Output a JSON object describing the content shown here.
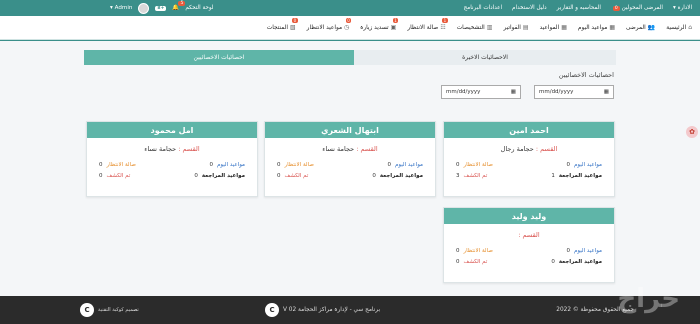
{
  "topbar": {
    "admin_menu": "الادارة ▾",
    "responsible_patients": "المرضى المحولين",
    "responsible_badge": "0",
    "accounts_reports": "المحاسبه و التقارير",
    "user_guide": "دليل الاستخدام",
    "program_settings": "اعدادات البرنامج",
    "dashboard": "لوحة التحكم",
    "notif_count": "+8",
    "bell_badge": "5",
    "admin_label": "Admin ▾"
  },
  "navbar": {
    "items": [
      {
        "label": "الرئيسية",
        "icon": "home-icon",
        "badge": ""
      },
      {
        "label": "المرضى",
        "icon": "users-icon",
        "badge": ""
      },
      {
        "label": "مواعيد اليوم",
        "icon": "calendar-icon",
        "badge": ""
      },
      {
        "label": "المواعيد",
        "icon": "calendar-icon",
        "badge": ""
      },
      {
        "label": "الفواتير",
        "icon": "invoice-icon",
        "badge": ""
      },
      {
        "label": "التشخيصات",
        "icon": "diagnosis-icon",
        "badge": ""
      },
      {
        "label": "صالة الانتظار",
        "icon": "waiting-icon",
        "badge": "1"
      },
      {
        "label": "تسديد زيارة",
        "icon": "payment-icon",
        "badge": "1"
      },
      {
        "label": "مواعيد الانتظار",
        "icon": "clock-icon",
        "badge": "0"
      },
      {
        "label": "المنتجات",
        "icon": "products-icon",
        "badge": "0"
      }
    ]
  },
  "tabs": {
    "recent_stats": "الاحصائيات الاخيرة",
    "specialist_stats": "احصائيات الاخصائيين"
  },
  "section_title": "احصائيات الاخصائيين",
  "date_inputs": [
    {
      "placeholder": "mm/dd/yyyy"
    },
    {
      "placeholder": "mm/dd/yyyy"
    }
  ],
  "labels": {
    "dept": "القسم :",
    "today_appointments": "مواعيد اليوم",
    "waiting_hall": "صالة الانتظار",
    "review_appointments": "مواعيد المراجعة",
    "examined": "تم الكشف"
  },
  "cards": [
    {
      "name": "احمد امين",
      "dept": "حجامة رجال",
      "today": "0",
      "waiting": "0",
      "review": "1",
      "examined": "3"
    },
    {
      "name": "ابتهال الشعري",
      "dept": "حجامة نساء",
      "today": "0",
      "waiting": "0",
      "review": "0",
      "examined": "0"
    },
    {
      "name": "امل محمود",
      "dept": "حجامة نساء",
      "today": "0",
      "waiting": "0",
      "review": "0",
      "examined": "0"
    },
    {
      "name": "وليد وليد",
      "dept": "",
      "today": "0",
      "waiting": "0",
      "review": "0",
      "examined": "0"
    }
  ],
  "footer": {
    "copyright": "جميع الحقوق محفوظة © 2022",
    "program": "برنامج سي - لإدارة مراكز الحجامة V 02",
    "design": "تصميم كوكبة التقنية",
    "watermark": "حراج"
  },
  "colors": {
    "teal": "#3a8f8a",
    "card_header": "#5fb5a8",
    "badge_red": "#e95a3b"
  }
}
